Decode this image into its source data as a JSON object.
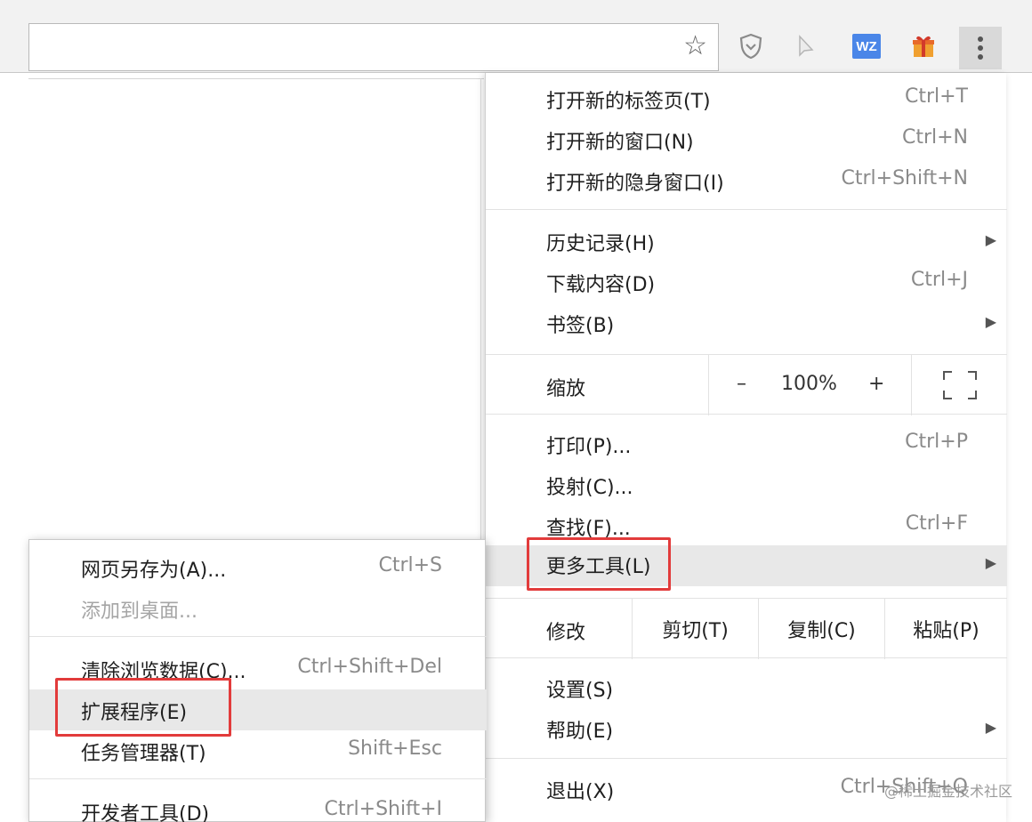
{
  "toolbar": {
    "bookmark_icon": "star-icon",
    "extensions": [
      "shield-icon",
      "cursor-icon",
      "wz-icon",
      "gift-icon"
    ],
    "wz_label": "WZ",
    "menu_icon": "vertical-dots-icon"
  },
  "main_menu": {
    "group1": [
      {
        "label": "打开新的标签页(T)",
        "shortcut": "Ctrl+T"
      },
      {
        "label": "打开新的窗口(N)",
        "shortcut": "Ctrl+N"
      },
      {
        "label": "打开新的隐身窗口(I)",
        "shortcut": "Ctrl+Shift+N"
      }
    ],
    "group2": [
      {
        "label": "历史记录(H)",
        "shortcut": ""
      },
      {
        "label": "下载内容(D)",
        "shortcut": "Ctrl+J"
      },
      {
        "label": "书签(B)",
        "shortcut": ""
      }
    ],
    "zoom": {
      "label": "缩放",
      "minus": "–",
      "value": "100%",
      "plus": "+"
    },
    "group3": [
      {
        "label": "打印(P)...",
        "shortcut": "Ctrl+P"
      },
      {
        "label": "投射(C)...",
        "shortcut": ""
      },
      {
        "label": "查找(F)...",
        "shortcut": "Ctrl+F"
      },
      {
        "label": "更多工具(L)",
        "shortcut": ""
      }
    ],
    "edit": {
      "label": "修改",
      "cut": "剪切(T)",
      "copy": "复制(C)",
      "paste": "粘贴(P)"
    },
    "group4": [
      {
        "label": "设置(S)",
        "shortcut": ""
      },
      {
        "label": "帮助(E)",
        "shortcut": ""
      }
    ],
    "exit": {
      "label": "退出(X)",
      "shortcut": "Ctrl+Shift+Q"
    }
  },
  "sub_menu": {
    "items": [
      {
        "label": "网页另存为(A)...",
        "shortcut": "Ctrl+S"
      },
      {
        "label": "添加到桌面...",
        "shortcut": ""
      },
      {
        "label": "清除浏览数据(C)...",
        "shortcut": "Ctrl+Shift+Del"
      },
      {
        "label": "扩展程序(E)",
        "shortcut": ""
      },
      {
        "label": "任务管理器(T)",
        "shortcut": "Shift+Esc"
      },
      {
        "label": "开发者工具(D)",
        "shortcut": "Ctrl+Shift+I"
      }
    ]
  },
  "watermark": "@稀土掘金技术社区",
  "colors": {
    "highlight_box": "#e23b3b",
    "hover_bg": "#e8e8e8"
  }
}
